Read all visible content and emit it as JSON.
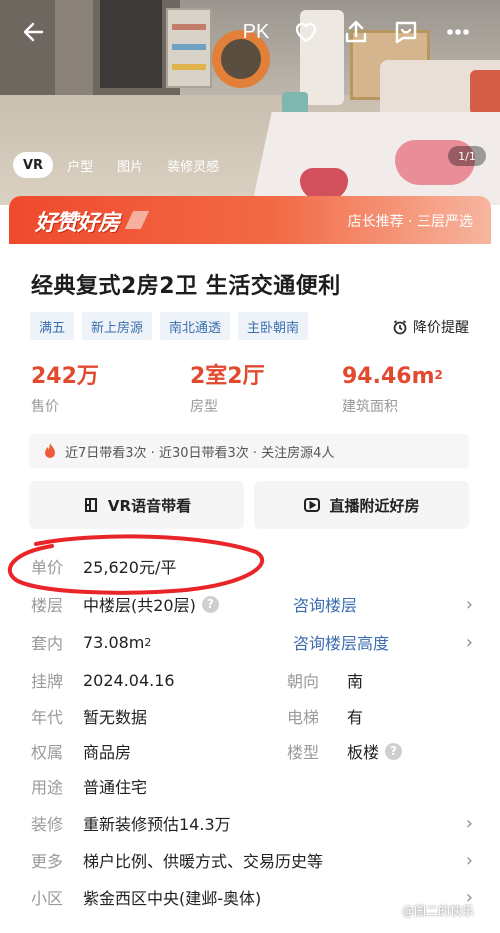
{
  "topbar": {
    "pk_label": "PK"
  },
  "media_tabs": [
    "VR",
    "户型",
    "图片",
    "装修灵感"
  ],
  "media_counter": "1/1",
  "banner": {
    "logo_text": "好赞好房",
    "right_text": "店长推荐 · 三层严选"
  },
  "title": "经典复式2房2卫 生活交通便利",
  "tags": [
    "满五",
    "新上房源",
    "南北通透",
    "主卧朝南"
  ],
  "price_alert": "降价提醒",
  "stats": [
    {
      "value": "242万",
      "label": "售价"
    },
    {
      "value": "2室2厅",
      "label": "房型"
    },
    {
      "value": "94.46m",
      "sup": "2",
      "label": "建筑面积"
    }
  ],
  "visits_text": "近7日带看3次 · 近30日带看3次 · 关注房源4人",
  "actions": {
    "vr_label": "VR语音带看",
    "live_label": "直播附近好房"
  },
  "details": {
    "unit_price": {
      "key": "单价",
      "value": "25,620元/平"
    },
    "floor": {
      "key": "楼层",
      "value": "中楼层(共20层)",
      "link": "咨询楼层"
    },
    "inner": {
      "key": "套内",
      "value": "73.08m",
      "sup": "2",
      "link": "咨询楼层高度"
    },
    "listed": {
      "key": "挂牌",
      "value": "2024.04.16",
      "key2": "朝向",
      "value2": "南"
    },
    "year": {
      "key": "年代",
      "value": "暂无数据",
      "key2": "电梯",
      "value2": "有"
    },
    "ownership": {
      "key": "权属",
      "value": "商品房",
      "key2": "楼型",
      "value2": "板楼"
    },
    "usage": {
      "key": "用途",
      "value": "普通住宅"
    },
    "decoration": {
      "key": "装修",
      "value": "重新装修预估14.3万"
    },
    "more": {
      "key": "更多",
      "value": "梯户比例、供暖方式、交易历史等"
    },
    "community": {
      "key": "小区",
      "value": "紫金西区中央(建邺-奥体)"
    }
  },
  "watermark": "@国二的快乐",
  "colors": {
    "accent_red": "#e14a2f",
    "banner_red": "#f04a2e",
    "tag_blue": "#3a6fae",
    "link_blue": "#3c6db1"
  }
}
